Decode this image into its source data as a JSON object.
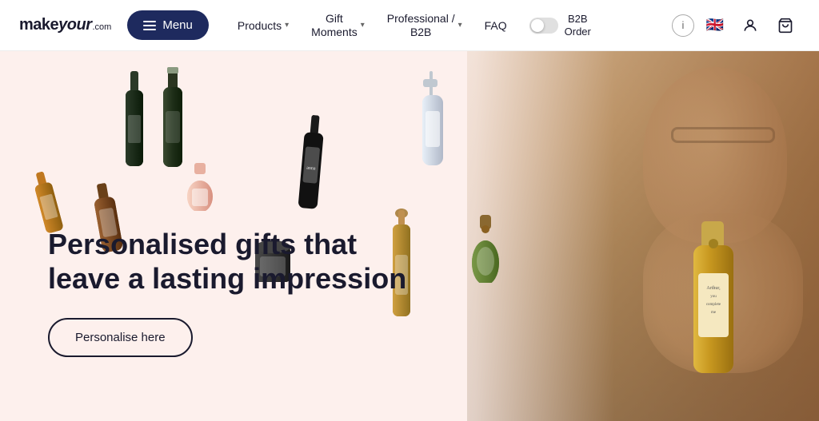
{
  "header": {
    "logo": {
      "make": "make",
      "your": "your",
      "com": ".com"
    },
    "menu_label": "Menu",
    "nav": [
      {
        "id": "products",
        "label": "Products",
        "has_dropdown": true
      },
      {
        "id": "gift-moments",
        "label": "Gift\nMoments",
        "has_dropdown": true
      },
      {
        "id": "professional-b2b",
        "label": "Professional /\nB2B",
        "has_dropdown": true
      },
      {
        "id": "faq",
        "label": "FAQ",
        "has_dropdown": false
      }
    ],
    "toggle": {
      "label_line1": "B2B",
      "label_line2": "Order"
    },
    "icons": {
      "info": "ℹ",
      "flag": "🇬🇧",
      "user": "👤",
      "cart": "🛒"
    }
  },
  "hero": {
    "background_color": "#fdf0ed",
    "title": "Personalised gifts that leave a lasting impression",
    "cta_button": "Personalise here",
    "bottle_label_text": "Arthur,\nyou\ncomplete\nme"
  }
}
